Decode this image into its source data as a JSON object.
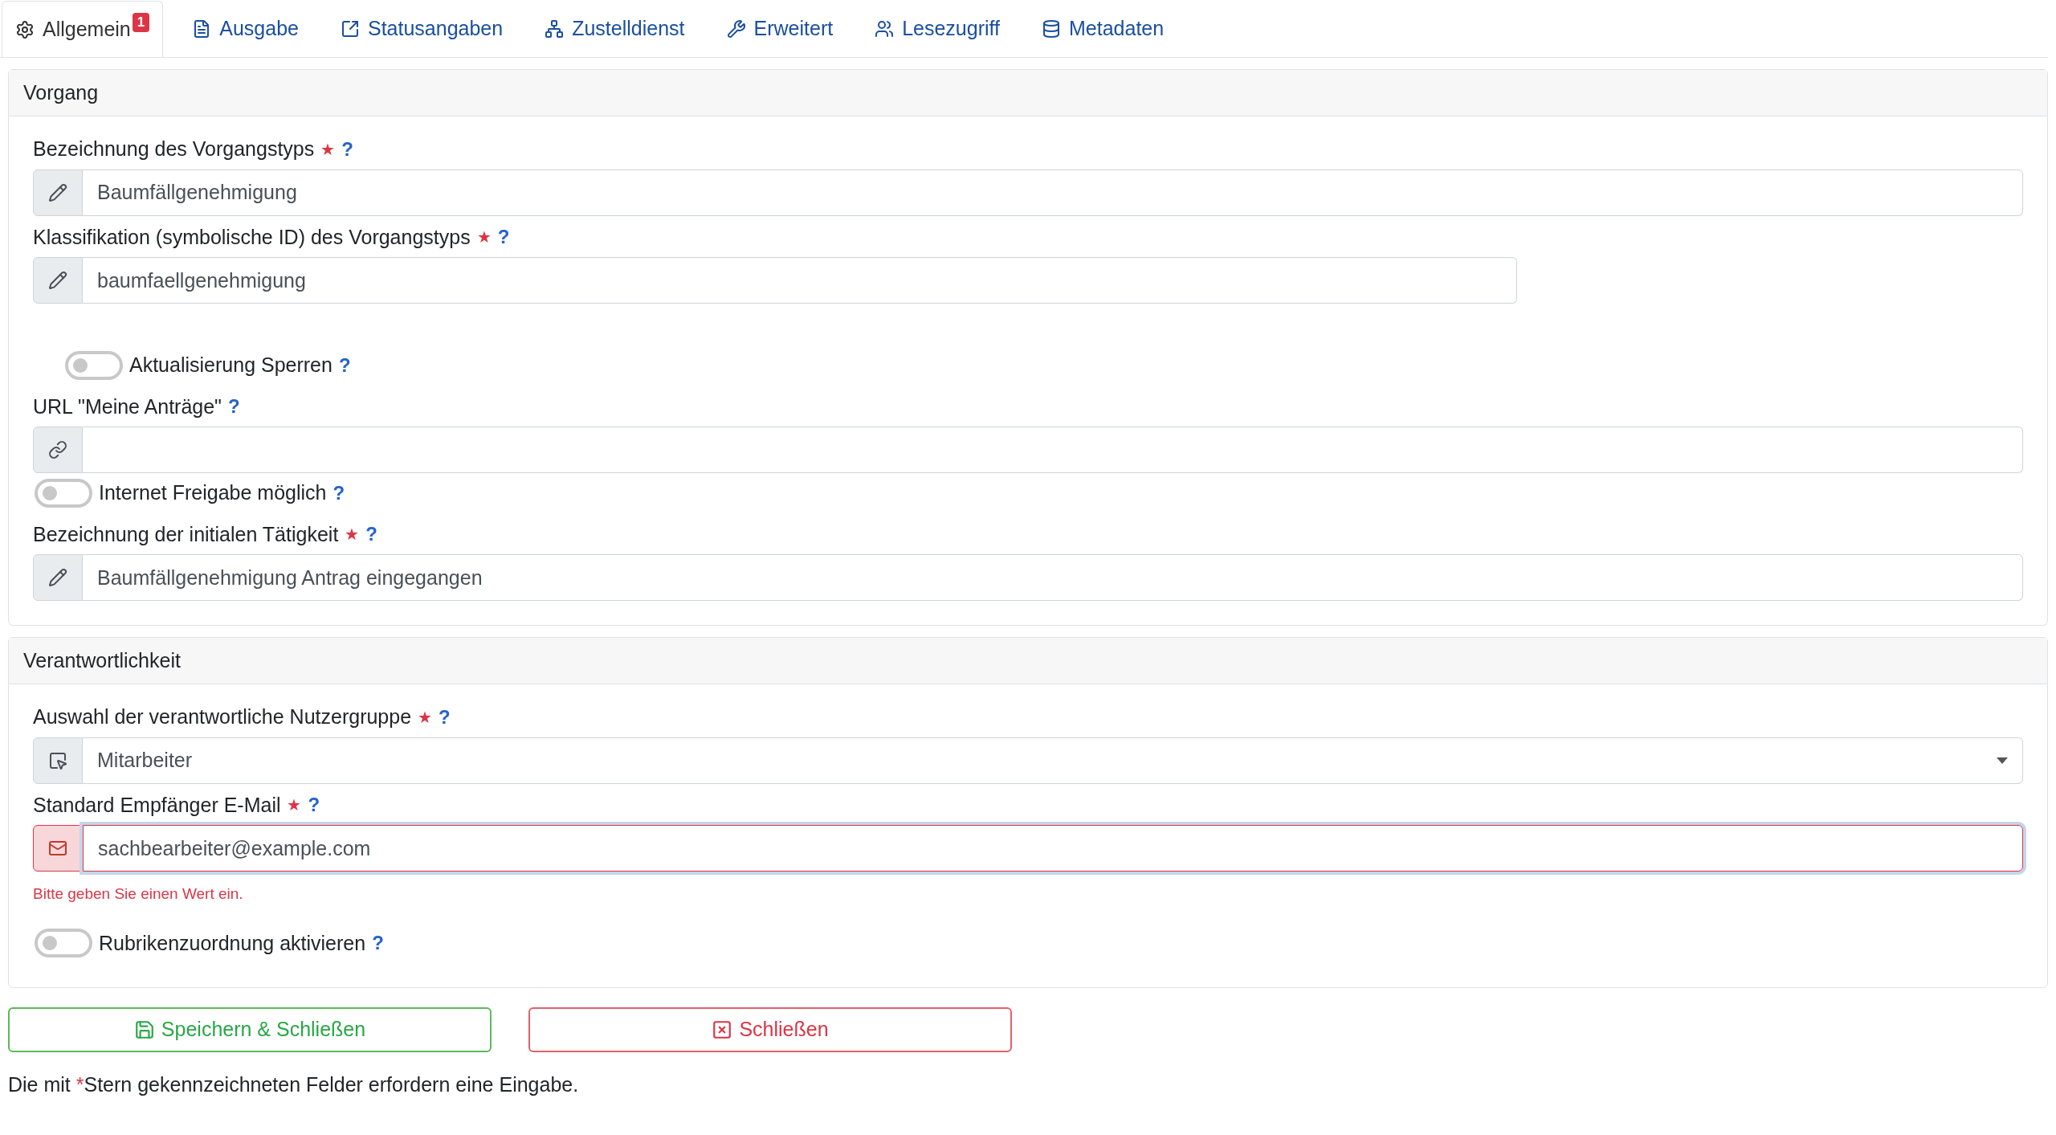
{
  "tabs": [
    {
      "label": "Allgemein",
      "selected": true,
      "badge": "1"
    },
    {
      "label": "Ausgabe",
      "selected": false
    },
    {
      "label": "Statusangaben",
      "selected": false
    },
    {
      "label": "Zustelldienst",
      "selected": false
    },
    {
      "label": "Erweitert",
      "selected": false
    },
    {
      "label": "Lesezugriff",
      "selected": false
    },
    {
      "label": "Metadaten",
      "selected": false
    }
  ],
  "sections": [
    {
      "title": "Vorgang",
      "fields": [
        {
          "kind": "text",
          "label": "Bezeichnung des Vorgangstyps",
          "required_mark": "★",
          "help": "?",
          "value": "Baumfällgenehmigung"
        },
        {
          "kind": "text",
          "label": "Klassifikation (symbolische ID) des Vorgangstyps",
          "required_mark": "★",
          "help": "?",
          "value": "baumfaellgenehmigung"
        },
        {
          "kind": "toggle",
          "label": "Aktualisierung Sperren",
          "help": "?",
          "on": false
        },
        {
          "kind": "url",
          "label": "URL \"Meine Anträge\"",
          "help": "?"
        },
        {
          "kind": "toggle",
          "label": "Internet Freigabe möglich",
          "help": "?",
          "on": false
        },
        {
          "kind": "text",
          "label": "Bezeichnung der initialen Tätigkeit",
          "required_mark": "★",
          "help": "?",
          "value": "Baumfällgenehmigung Antrag eingegangen"
        }
      ]
    },
    {
      "title": "Verantwortlichkeit",
      "fields": [
        {
          "kind": "select",
          "label": "Auswahl der verantwortliche Nutzergruppe",
          "required_mark": "★",
          "help": "?",
          "value": "Mitarbeiter"
        },
        {
          "kind": "email",
          "label": "Standard Empfänger E-Mail",
          "required_mark": "★",
          "help": "?",
          "value": "sachbearbeiter@example.com",
          "invalid": true,
          "focused": true,
          "error": "Bitte geben Sie einen Wert ein."
        },
        {
          "kind": "toggle",
          "label": "Rubrikenzuordnung aktivieren",
          "help": "?",
          "on": false
        }
      ]
    }
  ],
  "buttons": [
    {
      "kind": "save",
      "label": "Speichern & Schließen"
    },
    {
      "kind": "close",
      "label": "Schließen"
    }
  ],
  "footer_note": {
    "before": "Die mit ",
    "mark": "*",
    "after": "Stern gekennzeichneten Felder erfordern eine Eingabe."
  }
}
